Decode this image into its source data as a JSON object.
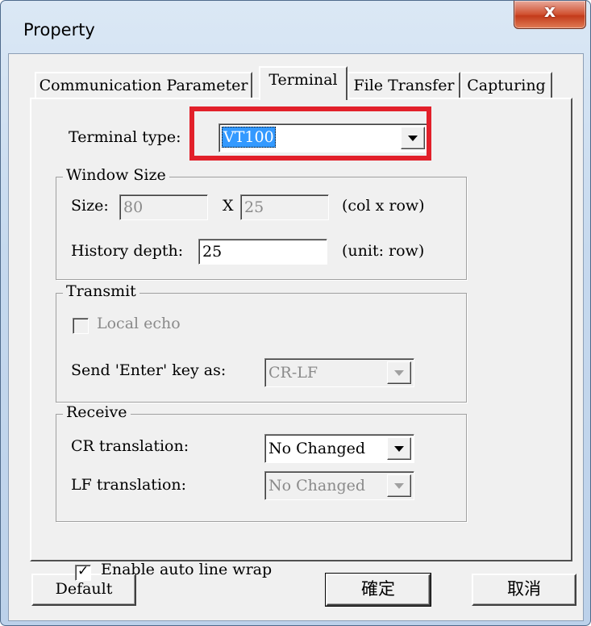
{
  "window": {
    "title": "Property",
    "close_glyph": "x"
  },
  "tabs": [
    {
      "label": "Communication Parameter",
      "active": false
    },
    {
      "label": "Terminal",
      "active": true
    },
    {
      "label": "File Transfer",
      "active": false
    },
    {
      "label": "Capturing",
      "active": false
    }
  ],
  "terminal_type": {
    "label": "Terminal type:",
    "value": "VT100"
  },
  "window_size": {
    "title": "Window Size",
    "size_label": "Size:",
    "cols": "80",
    "separator": "X",
    "rows": "25",
    "unit": "(col x row)",
    "history_label": "History depth:",
    "history_value": "25",
    "history_unit": "(unit: row)"
  },
  "transmit": {
    "title": "Transmit",
    "local_echo_label": "Local echo",
    "local_echo_checked": false,
    "send_enter_label": "Send 'Enter' key  as:",
    "send_enter_value": "CR-LF"
  },
  "receive": {
    "title": "Receive",
    "cr_label": "CR translation:",
    "cr_value": "No Changed",
    "lf_label": "LF translation:",
    "lf_value": "No Changed"
  },
  "auto_wrap": {
    "label": "Enable auto line wrap",
    "checked": true,
    "tick_glyph": "✓"
  },
  "buttons": {
    "default": "Default",
    "ok": "確定",
    "cancel": "取消"
  },
  "colors": {
    "highlight": "#e2202a",
    "selection": "#3399ff"
  }
}
